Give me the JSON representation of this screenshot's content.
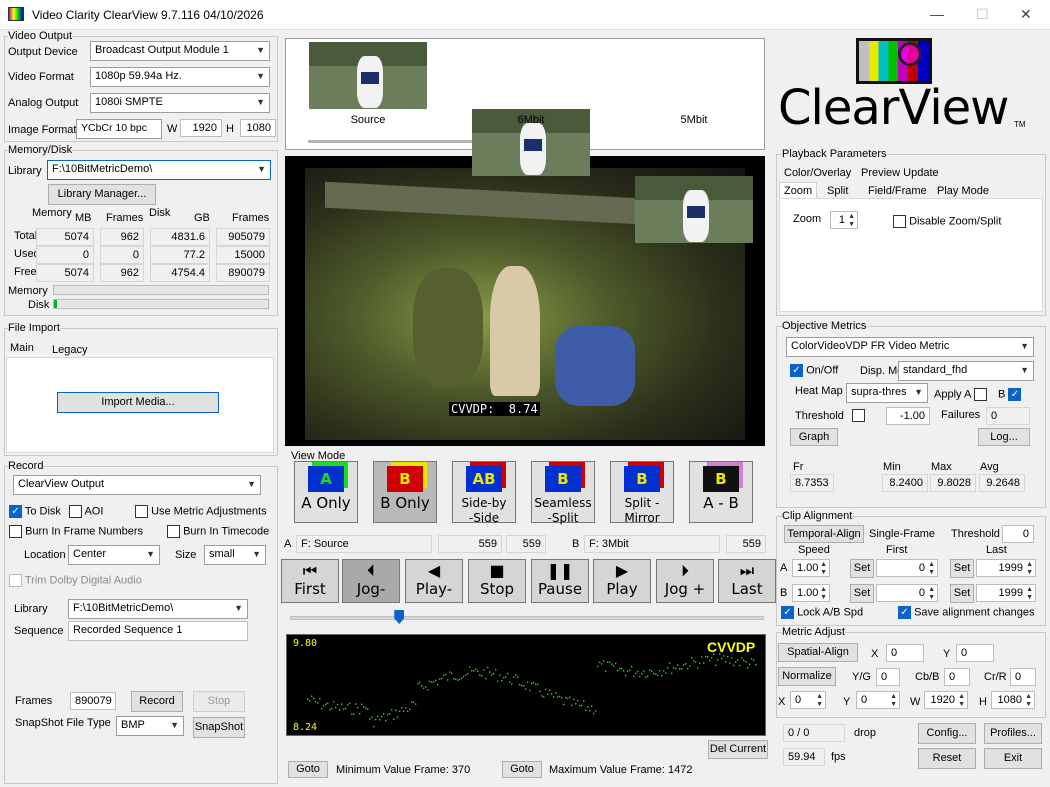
{
  "window": {
    "title": "Video Clarity ClearView  9.7.116  04/10/2026",
    "min_icon": "minimize-icon",
    "max_icon": "maximize-icon",
    "close_icon": "close-icon"
  },
  "video_output": {
    "group_label": "Video Output",
    "device_label": "Output Device",
    "device_value": "Broadcast Output Module 1",
    "format_label": "Video Format",
    "format_value": "1080p 59.94a Hz.",
    "analog_label": "Analog Output",
    "analog_value": "1080i SMPTE",
    "image_format_label": "Image Format",
    "image_format_value": "YCbCr 10 bpc",
    "w_label": "W",
    "w_value": "1920",
    "h_label": "H",
    "h_value": "1080"
  },
  "memory_disk": {
    "group_label": "Memory/Disk",
    "library_label": "Library",
    "library_value": "F:\\10BitMetricDemo\\",
    "library_manager_label": "Library Manager...",
    "hdr_memory": "Memory",
    "hdr_disk": "Disk",
    "hdr_mb": "MB",
    "hdr_frames1": "Frames",
    "hdr_gb": "GB",
    "hdr_frames2": "Frames",
    "rows": [
      {
        "label": "Total",
        "mb": "5074",
        "frames": "962",
        "gb": "4831.6",
        "dframes": "905079"
      },
      {
        "label": "Used",
        "mb": "0",
        "frames": "0",
        "gb": "77.2",
        "dframes": "15000"
      },
      {
        "label": "Free",
        "mb": "5074",
        "frames": "962",
        "gb": "4754.4",
        "dframes": "890079"
      }
    ],
    "memory_bar_label": "Memory",
    "disk_bar_label": "Disk",
    "memory_level": 0,
    "disk_level": 0.016
  },
  "file_import": {
    "group_label": "File Import",
    "tab_main": "Main",
    "tab_legacy": "Legacy",
    "import_label": "Import Media..."
  },
  "record": {
    "group_label": "Record",
    "output_value": "ClearView Output",
    "to_disk": "To Disk",
    "aoi": "AOI",
    "use_metric": "Use Metric Adjustments",
    "burn_frames": "Burn In Frame Numbers",
    "burn_timecode": "Burn In Timecode",
    "location_label": "Location",
    "location_value": "Center",
    "size_label": "Size",
    "size_value": "small",
    "trim_dolby": "Trim Dolby Digital Audio",
    "library_label": "Library",
    "library_value": "F:\\10BitMetricDemo\\",
    "sequence_label": "Sequence",
    "sequence_value": "Recorded Sequence 1",
    "frames_label": "Frames",
    "frames_value": "890079",
    "record_label": "Record",
    "stop_label": "Stop",
    "snapshot_type_label": "SnapShot File Type",
    "snapshot_type_value": "BMP",
    "snapshot_label": "SnapShot"
  },
  "thumbnails": [
    {
      "label": "Source"
    },
    {
      "label": "6Mbit"
    },
    {
      "label": "5Mbit"
    }
  ],
  "video": {
    "overlay": "CVVDP:  8.74"
  },
  "view_mode": {
    "group_label": "View Mode",
    "buttons": [
      {
        "label": "A Only",
        "letter": "A"
      },
      {
        "label": "B Only",
        "letter": "B"
      },
      {
        "label": "Side-by\n-Side",
        "letter": "AB"
      },
      {
        "label": "Seamless\n-Split",
        "letter": "B"
      },
      {
        "label": "Split -\nMirror",
        "letter": "B"
      },
      {
        "label": "A - B",
        "letter": "B"
      }
    ]
  },
  "clips": {
    "a_label": "A",
    "a_name": "F: Source",
    "a_frame1": "559",
    "a_frame2": "559",
    "b_label": "B",
    "b_name": "F: 3Mbit",
    "b_frame": "559"
  },
  "transport": [
    {
      "label": "First",
      "icon": "first-frame-icon",
      "glyph": "⏮"
    },
    {
      "label": "Jog-",
      "icon": "jog-back-icon",
      "glyph": "⏴"
    },
    {
      "label": "Play-",
      "icon": "play-reverse-icon",
      "glyph": "◀"
    },
    {
      "label": "Stop",
      "icon": "stop-icon",
      "glyph": "■"
    },
    {
      "label": "Pause",
      "icon": "pause-icon",
      "glyph": "❚❚"
    },
    {
      "label": "Play",
      "icon": "play-icon",
      "glyph": "▶"
    },
    {
      "label": "Jog +",
      "icon": "jog-forward-icon",
      "glyph": "⏵"
    },
    {
      "label": "Last",
      "icon": "last-frame-icon",
      "glyph": "⏭"
    }
  ],
  "graph": {
    "max_label": "9.80",
    "min_label": "8.24",
    "metric_label": "CVVDP",
    "del_current": "Del Current",
    "goto1": "Goto",
    "min_frame_text": "Minimum Value Frame: 370",
    "goto2": "Goto",
    "max_frame_text": "Maximum Value Frame: 1472",
    "position": 0.22
  },
  "logo": {
    "text": "ClearView",
    "tm": "TM"
  },
  "playback": {
    "group_label": "Playback Parameters",
    "tabs1": [
      "Color/Overlay",
      "Preview Update"
    ],
    "tabs2": [
      "Zoom",
      "Split",
      "Field/Frame",
      "Play Mode"
    ],
    "zoom_label": "Zoom",
    "zoom_value": "1",
    "disable_zoom": "Disable Zoom/Split"
  },
  "metrics": {
    "group_label": "Objective Metrics",
    "metric_value": "ColorVideoVDP FR Video Metric",
    "onoff": "On/Off",
    "disp_mdl_label": "Disp. Mdl",
    "disp_mdl_value": "standard_fhd",
    "heatmap_label": "Heat Map",
    "heatmap_value": "supra-thres",
    "apply_a": "Apply A",
    "b_label": "B",
    "threshold_label": "Threshold",
    "threshold_value": "-1.00",
    "failures_label": "Failures",
    "failures_value": "0",
    "graph_btn": "Graph",
    "log_btn": "Log...",
    "fr_label": "Fr",
    "fr_value": "8.7353",
    "min_label": "Min",
    "min_value": "8.2400",
    "max_label": "Max",
    "max_value": "9.8028",
    "avg_label": "Avg",
    "avg_value": "9.2648"
  },
  "clip_align": {
    "group_label": "Clip Alignment",
    "temporal_btn": "Temporal-Align",
    "single_frame": "Single-Frame",
    "threshold_label": "Threshold",
    "threshold_value": "0",
    "speed_label": "Speed",
    "first_label": "First",
    "last_label": "Last",
    "a_label": "A",
    "a_speed": "1.00",
    "a_first": "0",
    "a_last": "1999",
    "b_label": "B",
    "b_speed": "1.00",
    "b_first": "0",
    "b_last": "1999",
    "set": "Set",
    "lock": "Lock A/B Spd",
    "save_changes": "Save alignment changes"
  },
  "metric_adjust": {
    "group_label": "Metric Adjust",
    "spatial_btn": "Spatial-Align",
    "x_label": "X",
    "x_value": "0",
    "y_label": "Y",
    "y_value": "0",
    "normalize_btn": "Normalize",
    "yg_label": "Y/G",
    "yg_value": "0",
    "cbb_label": "Cb/B",
    "cbb_value": "0",
    "crr_label": "Cr/R",
    "crr_value": "0",
    "x2_label": "X",
    "x2_value": "0",
    "y2_label": "Y",
    "y2_value": "0",
    "w_label": "W",
    "w_value": "1920",
    "h_label": "H",
    "h_value": "1080"
  },
  "bottom": {
    "drop_value": "0 / 0",
    "drop_label": "drop",
    "fps_value": "59.94",
    "fps_label": "fps",
    "config": "Config...",
    "profiles": "Profiles...",
    "reset": "Reset",
    "exit": "Exit"
  }
}
